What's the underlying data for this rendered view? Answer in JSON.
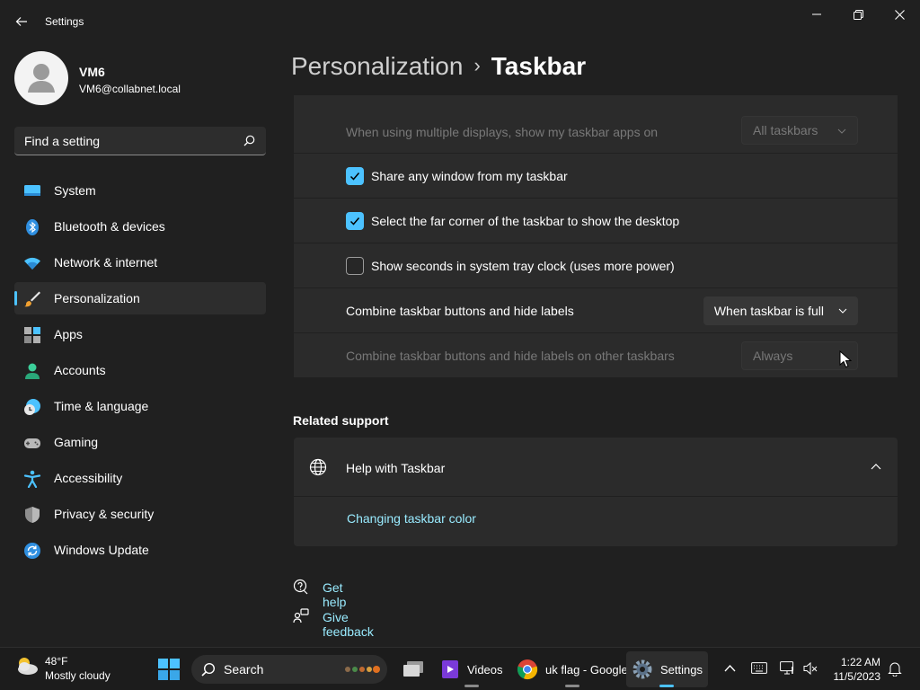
{
  "window": {
    "title": "Settings"
  },
  "profile": {
    "name": "VM6",
    "email": "VM6@collabnet.local"
  },
  "search": {
    "placeholder": "Find a setting"
  },
  "sidebar": {
    "items": [
      {
        "label": "System",
        "icon": "system-icon",
        "active": false
      },
      {
        "label": "Bluetooth & devices",
        "icon": "bluetooth-icon",
        "active": false
      },
      {
        "label": "Network & internet",
        "icon": "wifi-icon",
        "active": false
      },
      {
        "label": "Personalization",
        "icon": "brush-icon",
        "active": true
      },
      {
        "label": "Apps",
        "icon": "apps-icon",
        "active": false
      },
      {
        "label": "Accounts",
        "icon": "accounts-icon",
        "active": false
      },
      {
        "label": "Time & language",
        "icon": "time-language-icon",
        "active": false
      },
      {
        "label": "Gaming",
        "icon": "gaming-icon",
        "active": false
      },
      {
        "label": "Accessibility",
        "icon": "accessibility-icon",
        "active": false
      },
      {
        "label": "Privacy & security",
        "icon": "shield-icon",
        "active": false
      },
      {
        "label": "Windows Update",
        "icon": "update-icon",
        "active": false
      }
    ]
  },
  "breadcrumb": {
    "parent": "Personalization",
    "separator": "›",
    "current": "Taskbar"
  },
  "settings": {
    "multiple_displays": {
      "label": "When using multiple displays, show my taskbar apps on",
      "value": "All taskbars",
      "disabled": true
    },
    "share_window": {
      "label": "Share any window from my taskbar",
      "checked": true
    },
    "far_corner": {
      "label": "Select the far corner of the taskbar to show the desktop",
      "checked": true
    },
    "show_seconds": {
      "label": "Show seconds in system tray clock (uses more power)",
      "checked": false
    },
    "combine": {
      "label": "Combine taskbar buttons and hide labels",
      "value": "When taskbar is full"
    },
    "combine_other": {
      "label": "Combine taskbar buttons and hide labels on other taskbars",
      "value": "Always",
      "disabled": true
    }
  },
  "related_support": {
    "title": "Related support",
    "help_title": "Help with Taskbar",
    "link": "Changing taskbar color"
  },
  "help": {
    "get_help": "Get help",
    "give_feedback": "Give feedback"
  },
  "taskbar": {
    "weather_temp": "48°F",
    "weather_desc": "Mostly cloudy",
    "search_label": "Search",
    "apps": [
      {
        "label": "Videos",
        "icon": "videos-icon"
      },
      {
        "label": "uk flag - Google",
        "icon": "chrome-icon"
      },
      {
        "label": "Settings",
        "icon": "settings-gear-icon"
      }
    ],
    "time": "1:22 AM",
    "date": "11/5/2023"
  },
  "colors": {
    "accent": "#4cc2ff",
    "link": "#99ebff",
    "background": "#202020",
    "card": "#2b2b2b"
  }
}
